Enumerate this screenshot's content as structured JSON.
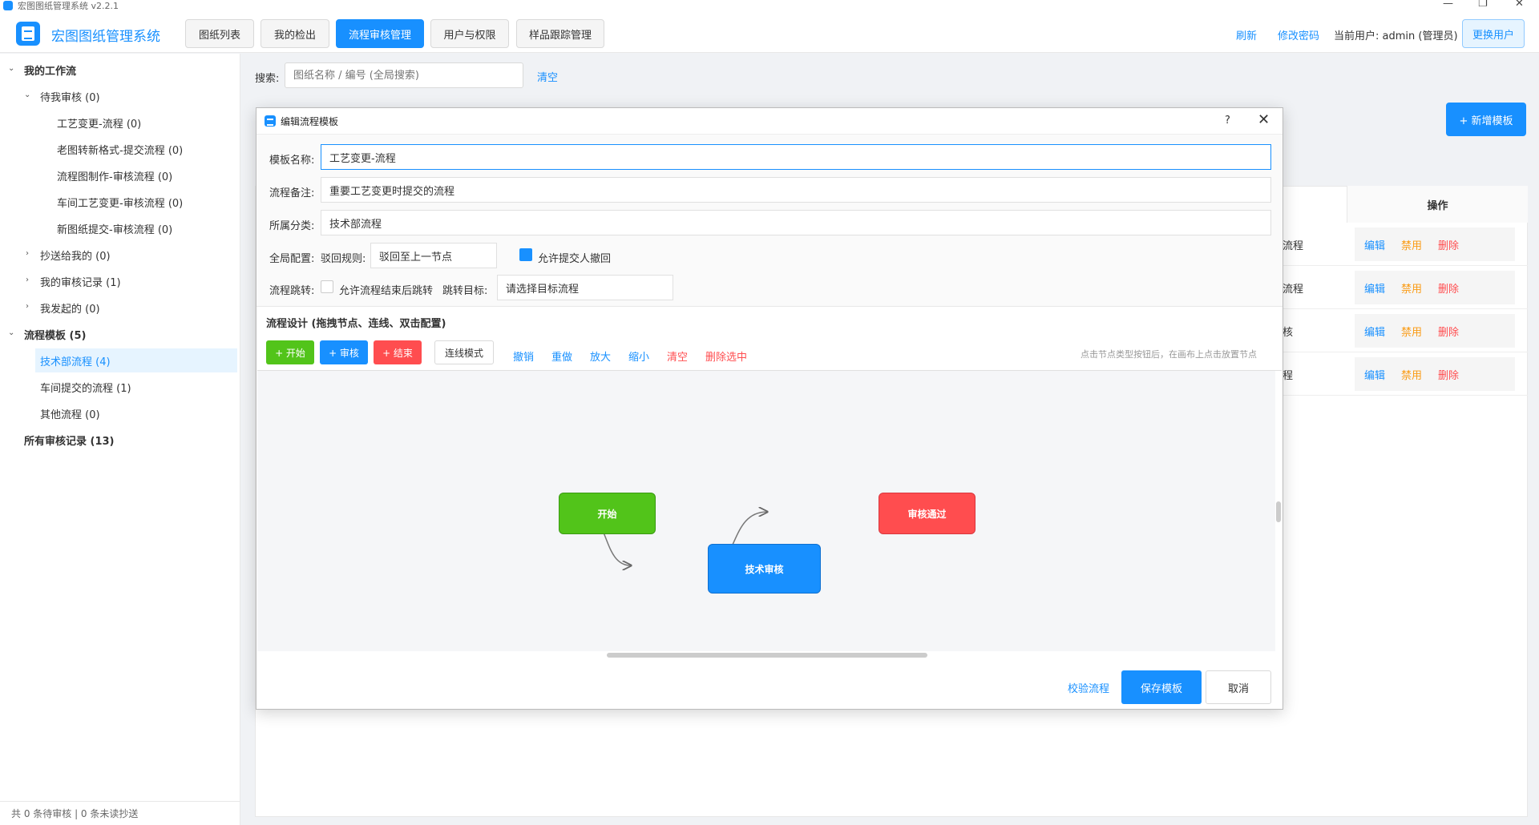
{
  "window": {
    "title": "宏图图纸管理系统  v2.2.1",
    "min": "—",
    "max": "❐",
    "close": "✕"
  },
  "header": {
    "app_name": "宏图图纸管理系统",
    "tabs": [
      {
        "label": "图纸列表"
      },
      {
        "label": "我的检出"
      },
      {
        "label": "流程审核管理"
      },
      {
        "label": "用户与权限"
      },
      {
        "label": "样品跟踪管理"
      }
    ],
    "refresh": "刷新",
    "change_password": "修改密码",
    "current_user": "当前用户: admin (管理员)",
    "switch_user": "更换用户"
  },
  "sidebar": {
    "my_workflow": "我的工作流",
    "pending": "待我审核 (0)",
    "pending_children": [
      "工艺变更-流程 (0)",
      "老图转新格式-提交流程 (0)",
      "流程图制作-审核流程 (0)",
      "车间工艺变更-审核流程 (0)",
      "新图纸提交-审核流程 (0)"
    ],
    "cc_to_me": "抄送给我的 (0)",
    "my_records": "我的审核记录 (1)",
    "i_initiated": "我发起的 (0)",
    "templates": "流程模板 (5)",
    "template_children": [
      "技术部流程 (4)",
      "车间提交的流程 (1)",
      "其他流程 (0)"
    ],
    "all_records": "所有审核记录 (13)",
    "status": "共 0 条待审核  |  0 条未读抄送"
  },
  "main": {
    "search_label": "搜索:",
    "search_placeholder": "图纸名称 / 编号 (全局搜索)",
    "clear": "清空",
    "add_template": "+ 新增模板",
    "ops_header": "操作",
    "rows": [
      {
        "frag": "流程",
        "edit": "编辑",
        "disable": "禁用",
        "delete": "删除"
      },
      {
        "frag": "流程",
        "edit": "编辑",
        "disable": "禁用",
        "delete": "删除"
      },
      {
        "frag": "核",
        "edit": "编辑",
        "disable": "禁用",
        "delete": "删除"
      },
      {
        "frag": "程",
        "edit": "编辑",
        "disable": "禁用",
        "delete": "删除"
      }
    ]
  },
  "dialog": {
    "title": "编辑流程模板",
    "help": "?",
    "close": "✕",
    "name_label": "模板名称:",
    "name_value": "工艺变更-流程",
    "note_label": "流程备注:",
    "note_value": "重要工艺变更时提交的流程",
    "category_label": "所属分类:",
    "category_value": "技术部流程",
    "global_label": "全局配置:",
    "reject_label": "驳回规则:",
    "reject_value": "驳回至上一节点",
    "allow_withdraw": "允许提交人撤回",
    "allow_withdraw_checked": true,
    "jump_label": "流程跳转:",
    "allow_jump": "允许流程结束后跳转",
    "allow_jump_checked": false,
    "jump_target_label": "跳转目标:",
    "jump_target_value": "请选择目标流程",
    "design_title": "流程设计 (拖拽节点、连线、双击配置)",
    "tools": {
      "start": "+ 开始",
      "review": "+ 审核",
      "end": "+ 结束",
      "connect": "连线模式",
      "undo": "撤销",
      "redo": "重做",
      "zoom_in": "放大",
      "zoom_out": "缩小",
      "clear": "清空",
      "delete_selected": "删除选中",
      "hint": "点击节点类型按钮后，在画布上点击放置节点"
    },
    "nodes": {
      "start": "开始",
      "tech_review": "技术审核",
      "approved": "审核通过"
    },
    "validate": "校验流程",
    "save": "保存模板",
    "cancel": "取消"
  },
  "colors": {
    "primary": "#1890ff",
    "start_node": "#52c41a",
    "review_node": "#1890ff",
    "end_node": "#ff4d4f",
    "warning": "#fa9b14"
  }
}
